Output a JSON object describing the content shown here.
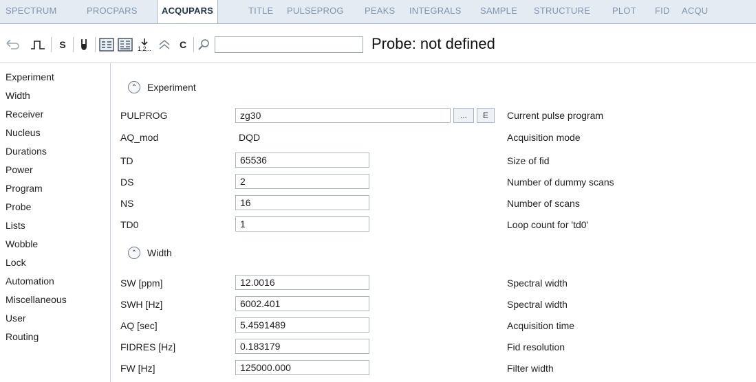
{
  "tabs": [
    {
      "label": "SPECTRUM"
    },
    {
      "label": "PROCPARS"
    },
    {
      "label": "ACQUPARS"
    },
    {
      "label": "TITLE"
    },
    {
      "label": "PULSEPROG"
    },
    {
      "label": "PEAKS"
    },
    {
      "label": "INTEGRALS"
    },
    {
      "label": "SAMPLE"
    },
    {
      "label": "STRUCTURE"
    },
    {
      "label": "PLOT"
    },
    {
      "label": "FID"
    },
    {
      "label": "ACQU"
    }
  ],
  "active_tab": "ACQUPARS",
  "toolbar": {
    "s_label": "S",
    "c_label": "C",
    "search_value": "",
    "probe_text": "Probe: not defined"
  },
  "sidebar": {
    "items": [
      {
        "label": "Experiment"
      },
      {
        "label": "Width"
      },
      {
        "label": "Receiver"
      },
      {
        "label": "Nucleus"
      },
      {
        "label": "Durations"
      },
      {
        "label": "Power"
      },
      {
        "label": "Program"
      },
      {
        "label": "Probe"
      },
      {
        "label": "Lists"
      },
      {
        "label": "Wobble"
      },
      {
        "label": "Lock"
      },
      {
        "label": "Automation"
      },
      {
        "label": "Miscellaneous"
      },
      {
        "label": "User"
      },
      {
        "label": "Routing"
      }
    ]
  },
  "sections": {
    "experiment": {
      "title": "Experiment",
      "params": [
        {
          "name": "PULPROG",
          "value": "zg30",
          "desc": "Current pulse program"
        },
        {
          "name": "AQ_mod",
          "value": "DQD",
          "desc": "Acquisition mode"
        },
        {
          "name": "TD",
          "value": "65536",
          "desc": "Size of fid"
        },
        {
          "name": "DS",
          "value": "2",
          "desc": "Number of dummy scans"
        },
        {
          "name": "NS",
          "value": "16",
          "desc": "Number of scans"
        },
        {
          "name": "TD0",
          "value": "1",
          "desc": "Loop count for 'td0'"
        }
      ],
      "browse_label": "...",
      "edit_label": "E"
    },
    "width": {
      "title": "Width",
      "params": [
        {
          "name": "SW [ppm]",
          "value": "12.0016",
          "desc": "Spectral width"
        },
        {
          "name": "SWH [Hz]",
          "value": "6002.401",
          "desc": "Spectral width"
        },
        {
          "name": "AQ [sec]",
          "value": "5.4591489",
          "desc": "Acquisition time"
        },
        {
          "name": "FIDRES [Hz]",
          "value": "0.183179",
          "desc": "Fid resolution"
        },
        {
          "name": "FW [Hz]",
          "value": "125000.000",
          "desc": "Filter width"
        }
      ]
    }
  }
}
